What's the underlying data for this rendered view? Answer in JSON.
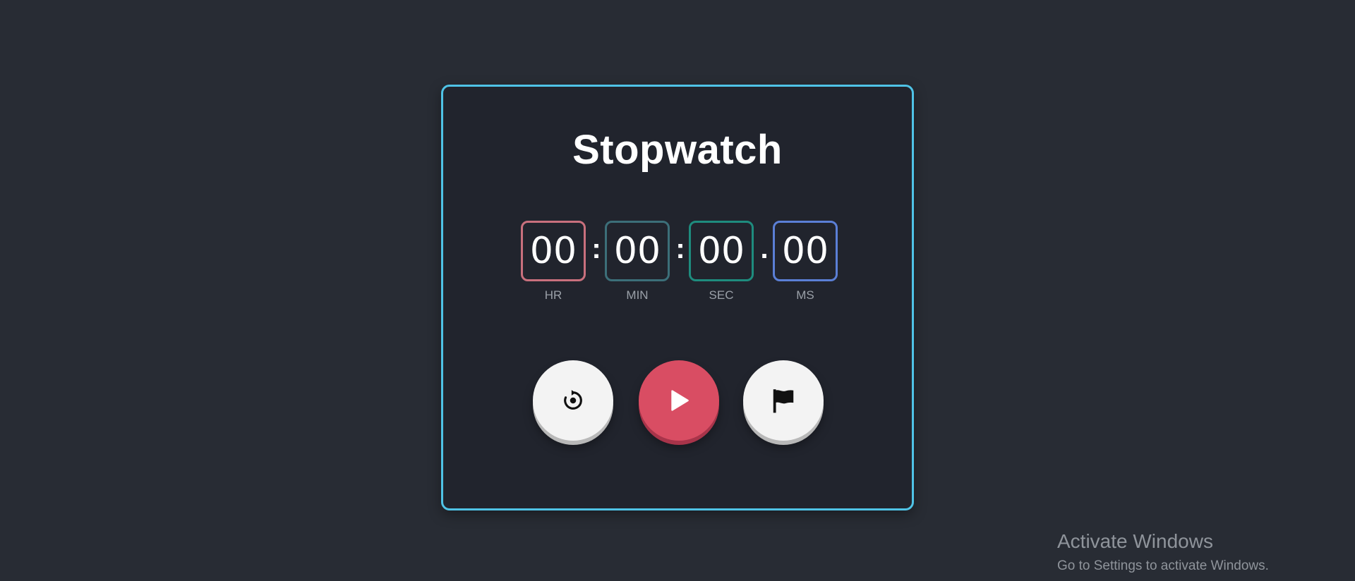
{
  "title": "Stopwatch",
  "timer": {
    "hours": "00",
    "minutes": "00",
    "seconds": "00",
    "milliseconds": "00",
    "labels": {
      "hours": "HR",
      "minutes": "MIN",
      "seconds": "SEC",
      "milliseconds": "MS"
    },
    "separators": [
      ":",
      ":",
      "."
    ],
    "colors": {
      "hours": "#c9707d",
      "minutes": "#3c6f79",
      "seconds": "#1e8c7e",
      "milliseconds": "#5b7fd6"
    }
  },
  "buttons": {
    "reset": {
      "icon": "reset-icon"
    },
    "start": {
      "icon": "play-icon",
      "color": "#d94d63"
    },
    "lap": {
      "icon": "flag-icon"
    }
  },
  "accent": "#4fc3e6",
  "watermark": {
    "title": "Activate Windows",
    "subtitle": "Go to Settings to activate Windows."
  }
}
